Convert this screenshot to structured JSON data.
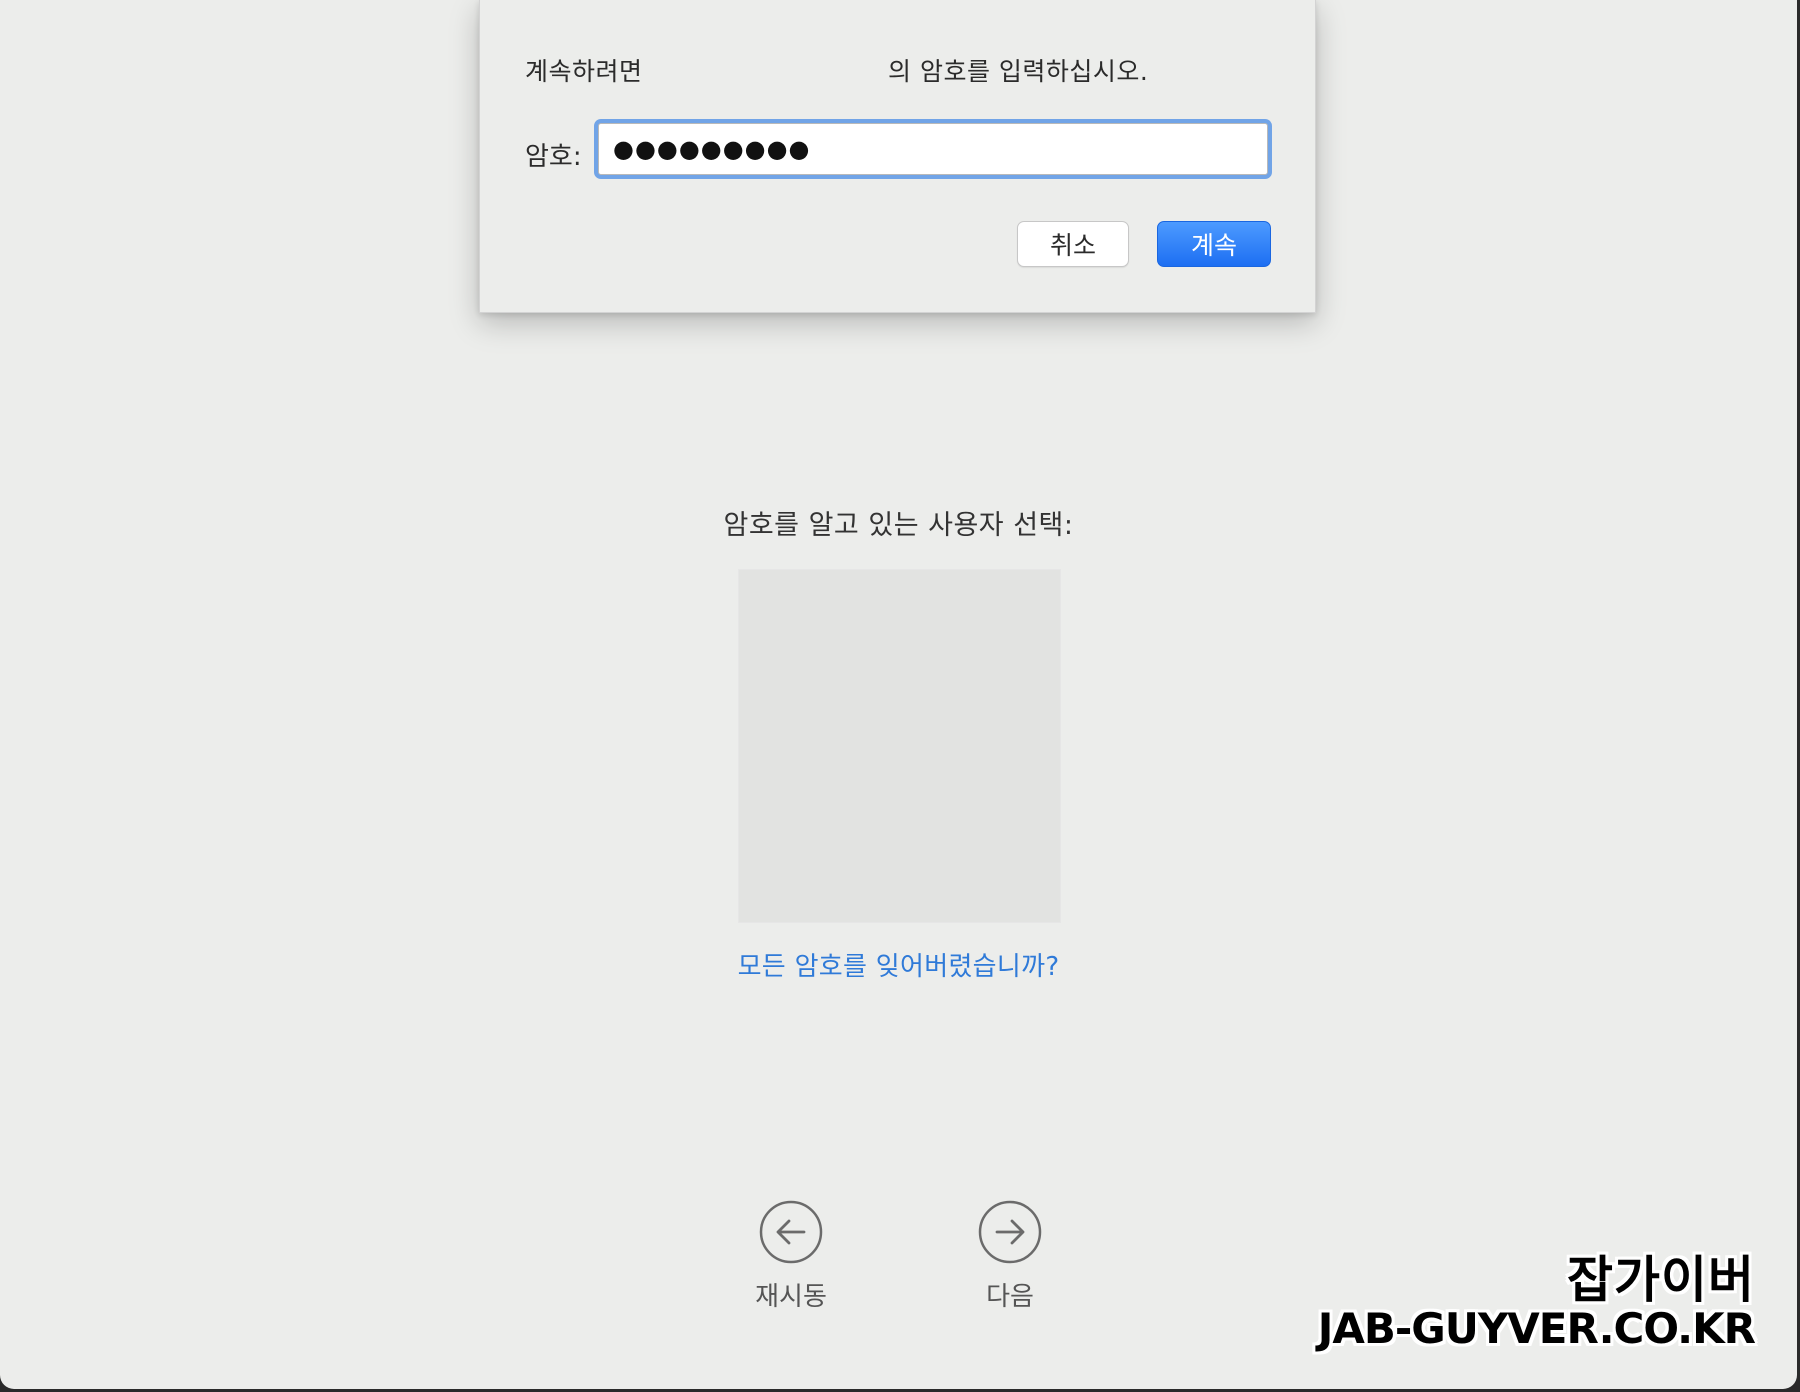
{
  "dialog": {
    "prompt_prefix": "계속하려면",
    "prompt_suffix": "의 암호를 입력하십시오.",
    "password_label": "암호:",
    "password_value": "●●●●●●●●●",
    "cancel_label": "취소",
    "continue_label": "계속"
  },
  "main": {
    "select_heading": "암호를 알고 있는 사용자 선택:",
    "forgot_link": "모든 암호를 잊어버렸습니까?"
  },
  "nav": {
    "restart_label": "재시동",
    "restart_icon": "arrow-left-circle-icon",
    "next_label": "다음",
    "next_icon": "arrow-right-circle-icon"
  },
  "watermark": {
    "title": "잡가이버",
    "url": "JAB-GUYVER.CO.KR"
  },
  "colors": {
    "background": "#ecedeb",
    "accent": "#1d6ff2",
    "link": "#2f7ad8"
  }
}
